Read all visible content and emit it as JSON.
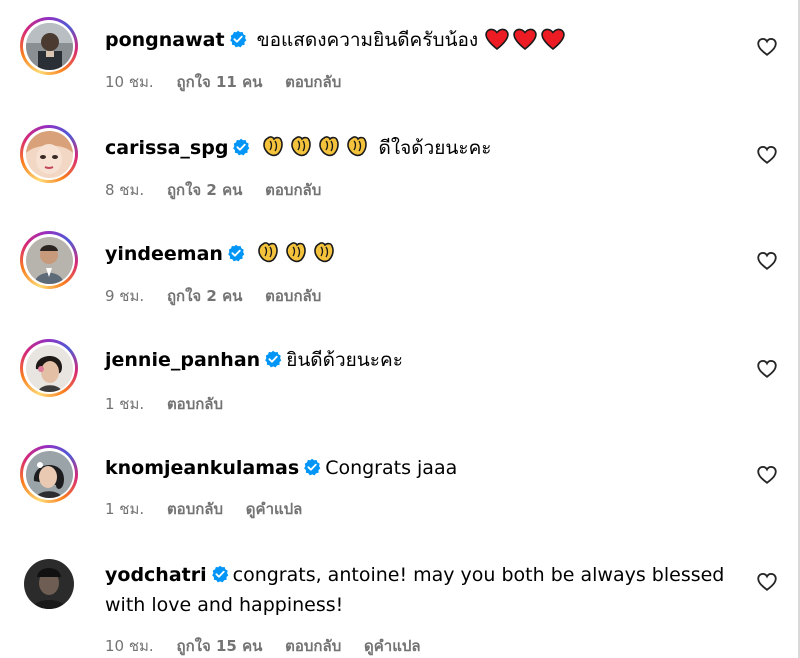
{
  "comments": [
    {
      "username": "pongnawat",
      "text": "ขอแสดงความยินดีครับน้อง",
      "emoji": "heart-icon",
      "emoji_count": 3,
      "time": "10 ชม.",
      "likes": "ถูกใจ 11 คน",
      "reply": "ตอบกลับ",
      "translate": ""
    },
    {
      "username": "carissa_spg",
      "text": "ดีใจด้วยนะคะ",
      "emoji": "clap-icon",
      "emoji_count": 4,
      "time": "8 ชม.",
      "likes": "ถูกใจ 2 คน",
      "reply": "ตอบกลับ",
      "translate": ""
    },
    {
      "username": "yindeeman",
      "text": "",
      "emoji": "clap-icon",
      "emoji_count": 3,
      "time": "9 ชม.",
      "likes": "ถูกใจ 2 คน",
      "reply": "ตอบกลับ",
      "translate": ""
    },
    {
      "username": "jennie_panhan",
      "text": "ยินดีด้วยนะคะ",
      "emoji": "",
      "emoji_count": 0,
      "time": "1 ชม.",
      "likes": "",
      "reply": "ตอบกลับ",
      "translate": ""
    },
    {
      "username": "knomjeankulamas",
      "text": "Congrats jaaa",
      "emoji": "",
      "emoji_count": 0,
      "time": "1 ชม.",
      "likes": "",
      "reply": "ตอบกลับ",
      "translate": "ดูคำแปล"
    },
    {
      "username": "yodchatri",
      "text": "congrats, antoine! may you both be always blessed with love and happiness!",
      "emoji": "",
      "emoji_count": 0,
      "time": "10 ชม.",
      "likes": "ถูกใจ 15 คน",
      "reply": "ตอบกลับ",
      "translate": "ดูคำแปล"
    }
  ],
  "colors": {
    "verified": "#0095f6",
    "meta": "#737373",
    "heart": "#ed1c24",
    "clap": "#f5c33b"
  }
}
